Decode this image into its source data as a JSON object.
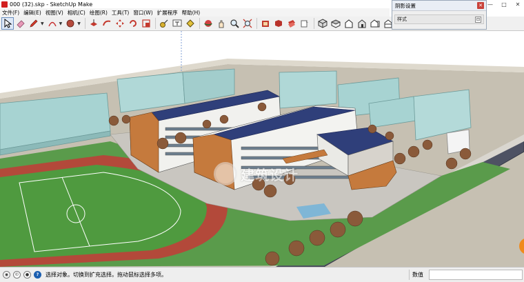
{
  "window": {
    "title": "000 (32).skp - SketchUp Make",
    "minimize": "—",
    "maximize": "□",
    "close": "✕"
  },
  "menu": {
    "items": [
      {
        "label": "文件(F)"
      },
      {
        "label": "编辑(E)"
      },
      {
        "label": "视图(V)"
      },
      {
        "label": "相机(C)"
      },
      {
        "label": "绘图(R)"
      },
      {
        "label": "工具(T)"
      },
      {
        "label": "窗口(W)"
      },
      {
        "label": "扩展程序"
      },
      {
        "label": "帮助(H)"
      }
    ]
  },
  "toolbar": {
    "groups": [
      [
        "select-icon",
        "eraser-icon",
        "pencil-icon",
        "arc-icon",
        "shape-icon"
      ],
      [
        "pushpull-icon",
        "followme-icon",
        "move-icon",
        "rotate-icon",
        "scale-icon"
      ],
      [
        "tape-icon",
        "text-icon",
        "paint-icon"
      ],
      [
        "orbit-icon",
        "pan-icon",
        "zoom-icon",
        "zoom-extents-icon"
      ],
      [
        "warehouse-icon",
        "extension-icon",
        "layout-icon",
        "share-icon"
      ],
      [
        "iso-view-icon",
        "top-view-icon",
        "front-view-icon",
        "right-view-icon",
        "back-view-icon",
        "left-view-icon"
      ]
    ]
  },
  "shadow_panel": {
    "title": "阴影设置",
    "close": "✕",
    "sub_label": "样式",
    "sub_toggle": "⊡"
  },
  "viewport": {
    "watermark_text": "建筑设计"
  },
  "status": {
    "message": "选择对象。切换到扩充选择。拖动鼠标选择多项。",
    "measurements_label": "数值",
    "measurements_value": ""
  },
  "colors": {
    "ground": "#c9c3b6",
    "grass": "#5a9b4b",
    "track": "#b3493a",
    "road": "#4e5263",
    "glass": "#a7d3d2",
    "roof": "#2f3f7a"
  }
}
